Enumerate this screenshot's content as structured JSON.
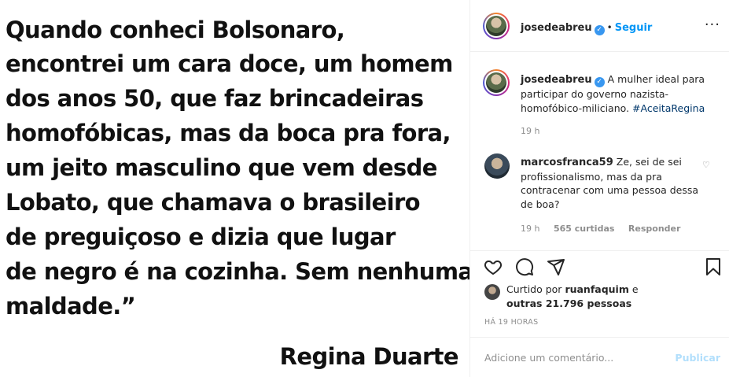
{
  "post_image": {
    "quote_lines": [
      "Quando conheci Bolsonaro,",
      "encontrei um cara doce, um homem",
      "dos anos 50, que faz brincadeiras",
      "homofóbicas, mas da boca pra fora,",
      "um jeito masculino que vem desde",
      "Lobato, que chamava o brasileiro",
      "de preguiçoso e dizia que lugar",
      "de negro é na cozinha. Sem nenhuma",
      "maldade.”"
    ],
    "author": "Regina Duarte"
  },
  "header": {
    "username": "josedeabreu",
    "separator": "•",
    "follow_label": "Seguir",
    "more_label": "···"
  },
  "caption": {
    "username": "josedeabreu",
    "text": "A mulher ideal para participar do governo nazista-homofóbico-miliciano.",
    "hashtag": "#AceitaRegina",
    "time": "19 h"
  },
  "comment": {
    "username": "marcosfranca59",
    "text": "Ze, sei de sei profissionalismo, mas da pra contracenar com uma pessoa dessa de boa?",
    "time": "19 h",
    "likes": "565 curtidas",
    "reply_label": "Responder"
  },
  "likes": {
    "prefix": "Curtido por",
    "user": "ruanfaquim",
    "suffix": "e",
    "others": "outras 21.796 pessoas"
  },
  "timestamp": "HÁ 19 HORAS",
  "add_comment": {
    "placeholder": "Adicione um comentário...",
    "publish_label": "Publicar"
  },
  "colors": {
    "accent": "#0095f6",
    "verified": "#3897f0",
    "muted": "#8e8e8e",
    "publish_disabled": "#b2dffc"
  }
}
